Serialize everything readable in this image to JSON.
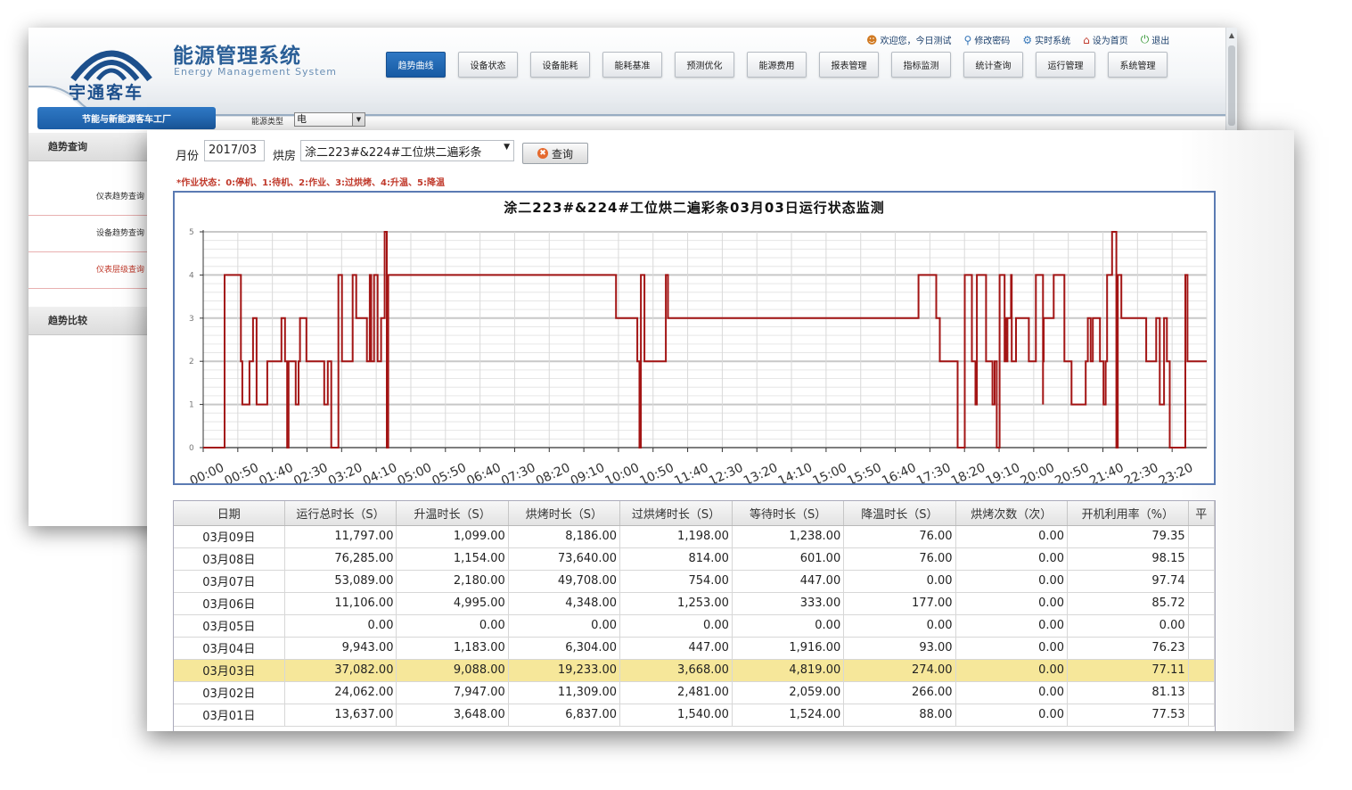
{
  "back": {
    "app_title": "能源管理系统",
    "app_subtitle": "Energy Management System",
    "logo_text": "宇通客车",
    "top_links": [
      {
        "label": "欢迎您，今日测试",
        "icon": "user-icon"
      },
      {
        "label": "修改密码",
        "icon": "key-search-icon"
      },
      {
        "label": "实时系统",
        "icon": "gear-icon"
      },
      {
        "label": "设为首页",
        "icon": "home-icon"
      },
      {
        "label": "退出",
        "icon": "power-icon"
      }
    ],
    "nav": [
      "趋势曲线",
      "设备状态",
      "设备能耗",
      "能耗基准",
      "预测优化",
      "能源费用",
      "报表管理",
      "指标监测",
      "统计查询",
      "运行管理",
      "系统管理"
    ],
    "dept_label": "节能与新能源客车工厂",
    "energy_type_label": "能源类型",
    "energy_type_value": "电",
    "sidebar": {
      "section1": "趋势查询",
      "items": [
        "仪表趋势查询",
        "设备趋势查询",
        "仪表层级查询"
      ],
      "section2": "趋势比较"
    },
    "colors": {
      "nav_active": "#1f66b1",
      "brand": "#1c4f8c"
    }
  },
  "front": {
    "month_label": "月份",
    "month_value": "2017/03",
    "room_label": "烘房",
    "room_value": "涂二223#&224#工位烘二遍彩条",
    "query_label": "查询",
    "status_note": "*作业状态：0:停机、1:待机、2:作业、3:过烘烤、4:升温、5:降温",
    "chart_data": {
      "type": "line",
      "title": "涂二223#&224#工位烘二遍彩条03月03日运行状态监测",
      "xlabel": "",
      "ylabel": "",
      "ylim": [
        0,
        5
      ],
      "yticks": [
        0,
        1,
        2,
        3,
        4,
        5
      ],
      "xlim": [
        0,
        1410
      ],
      "xtick_labels": [
        "00:00",
        "00:50",
        "01:40",
        "02:30",
        "03:20",
        "04:10",
        "05:00",
        "05:50",
        "06:40",
        "07:30",
        "08:20",
        "09:10",
        "10:00",
        "10:50",
        "11:40",
        "12:30",
        "13:20",
        "14:10",
        "15:00",
        "15:50",
        "16:40",
        "17:30",
        "18:20",
        "19:10",
        "20:00",
        "20:50",
        "21:40",
        "22:30",
        "23:20"
      ],
      "grid": true,
      "line_color": "#a31515",
      "series": [
        {
          "x": [
            0,
            30,
            30,
            53,
            53,
            55,
            55,
            65,
            65,
            70,
            70,
            75,
            75,
            90,
            90,
            110,
            110,
            115,
            115,
            118,
            118,
            120,
            120,
            130,
            130,
            134,
            134,
            136,
            136,
            145,
            145,
            170,
            170,
            175,
            175,
            180,
            180,
            190,
            190,
            195,
            195,
            210,
            210,
            215,
            215,
            230,
            230,
            234,
            234,
            236,
            236,
            240,
            240,
            245,
            245,
            250,
            250,
            255,
            255,
            258,
            258,
            260,
            260,
            580,
            580,
            610,
            610,
            613,
            613,
            615,
            615,
            620,
            620,
            650,
            650,
            653,
            653,
            1005,
            1005,
            1030,
            1030,
            1035,
            1035,
            1060,
            1060,
            1070,
            1070,
            1080,
            1080,
            1085,
            1085,
            1087,
            1087,
            1100,
            1100,
            1109,
            1109,
            1112,
            1112,
            1115,
            1115,
            1119,
            1119,
            1126,
            1126,
            1128,
            1128,
            1129,
            1129,
            1130,
            1130,
            1135,
            1135,
            1136,
            1136,
            1142,
            1142,
            1160,
            1160,
            1170,
            1170,
            1180,
            1180,
            1180,
            1180,
            1180,
            1180,
            1181,
            1181,
            1195,
            1195,
            1210,
            1210,
            1220,
            1220,
            1240,
            1240,
            1243,
            1243,
            1247,
            1247,
            1250,
            1250,
            1260,
            1260,
            1265,
            1265,
            1268,
            1268,
            1270,
            1270,
            1277,
            1277,
            1283,
            1283,
            1285,
            1285,
            1290,
            1290,
            1325,
            1325,
            1339,
            1339,
            1344,
            1344,
            1350,
            1350,
            1354,
            1354,
            1358,
            1358,
            1380,
            1380,
            1383,
            1383,
            1410
          ],
          "y": [
            0,
            0,
            4,
            4,
            2,
            2,
            1,
            1,
            2,
            2,
            3,
            3,
            1,
            1,
            2,
            2,
            3,
            3,
            2,
            2,
            0,
            0,
            2,
            2,
            1,
            1,
            2,
            2,
            3,
            3,
            2,
            2,
            1,
            1,
            2,
            2,
            0,
            0,
            4,
            4,
            2,
            2,
            4,
            4,
            3,
            3,
            2,
            2,
            4,
            4,
            2,
            2,
            4,
            4,
            2,
            2,
            3,
            3,
            5,
            5,
            0,
            0,
            4,
            4,
            3,
            3,
            2,
            2,
            0,
            0,
            4,
            4,
            2,
            2,
            4,
            4,
            3,
            3,
            4,
            4,
            3,
            3,
            2,
            2,
            0,
            0,
            4,
            4,
            2,
            2,
            1,
            1,
            4,
            4,
            2,
            2,
            1,
            1,
            2,
            2,
            0,
            0,
            4,
            4,
            2,
            2,
            3,
            3,
            2,
            2,
            3,
            3,
            4,
            4,
            2,
            2,
            3,
            3,
            2,
            2,
            4,
            4,
            2,
            2,
            1,
            1,
            2,
            2,
            3,
            3,
            4,
            4,
            2,
            2,
            1,
            1,
            2,
            2,
            3,
            3,
            2,
            2,
            3,
            3,
            2,
            2,
            1,
            1,
            2,
            2,
            4,
            4,
            5,
            5,
            0,
            0,
            4,
            4,
            3,
            3,
            2,
            2,
            3,
            3,
            1,
            1,
            3,
            3,
            2,
            2,
            0,
            0,
            4,
            4,
            2,
            2,
            0,
            0
          ]
        }
      ]
    },
    "table": {
      "headers": [
        "日期",
        "运行总时长（S）",
        "升温时长（S）",
        "烘烤时长（S）",
        "过烘烤时长（S）",
        "等待时长（S）",
        "降温时长（S）",
        "烘烤次数（次）",
        "开机利用率（%）",
        "平"
      ],
      "rows": [
        [
          "03月09日",
          "11,797.00",
          "1,099.00",
          "8,186.00",
          "1,198.00",
          "1,238.00",
          "76.00",
          "0.00",
          "79.35",
          ""
        ],
        [
          "03月08日",
          "76,285.00",
          "1,154.00",
          "73,640.00",
          "814.00",
          "601.00",
          "76.00",
          "0.00",
          "98.15",
          ""
        ],
        [
          "03月07日",
          "53,089.00",
          "2,180.00",
          "49,708.00",
          "754.00",
          "447.00",
          "0.00",
          "0.00",
          "97.74",
          ""
        ],
        [
          "03月06日",
          "11,106.00",
          "4,995.00",
          "4,348.00",
          "1,253.00",
          "333.00",
          "177.00",
          "0.00",
          "85.72",
          ""
        ],
        [
          "03月05日",
          "0.00",
          "0.00",
          "0.00",
          "0.00",
          "0.00",
          "0.00",
          "0.00",
          "0.00",
          ""
        ],
        [
          "03月04日",
          "9,943.00",
          "1,183.00",
          "6,304.00",
          "447.00",
          "1,916.00",
          "93.00",
          "0.00",
          "76.23",
          ""
        ],
        [
          "03月03日",
          "37,082.00",
          "9,088.00",
          "19,233.00",
          "3,668.00",
          "4,819.00",
          "274.00",
          "0.00",
          "77.11",
          ""
        ],
        [
          "03月02日",
          "24,062.00",
          "7,947.00",
          "11,309.00",
          "2,481.00",
          "2,059.00",
          "266.00",
          "0.00",
          "81.13",
          ""
        ],
        [
          "03月01日",
          "13,637.00",
          "3,648.00",
          "6,837.00",
          "1,540.00",
          "1,524.00",
          "88.00",
          "0.00",
          "77.53",
          ""
        ]
      ],
      "highlighted_row": "03月03日",
      "highlight_color": "#f6e79a"
    }
  }
}
